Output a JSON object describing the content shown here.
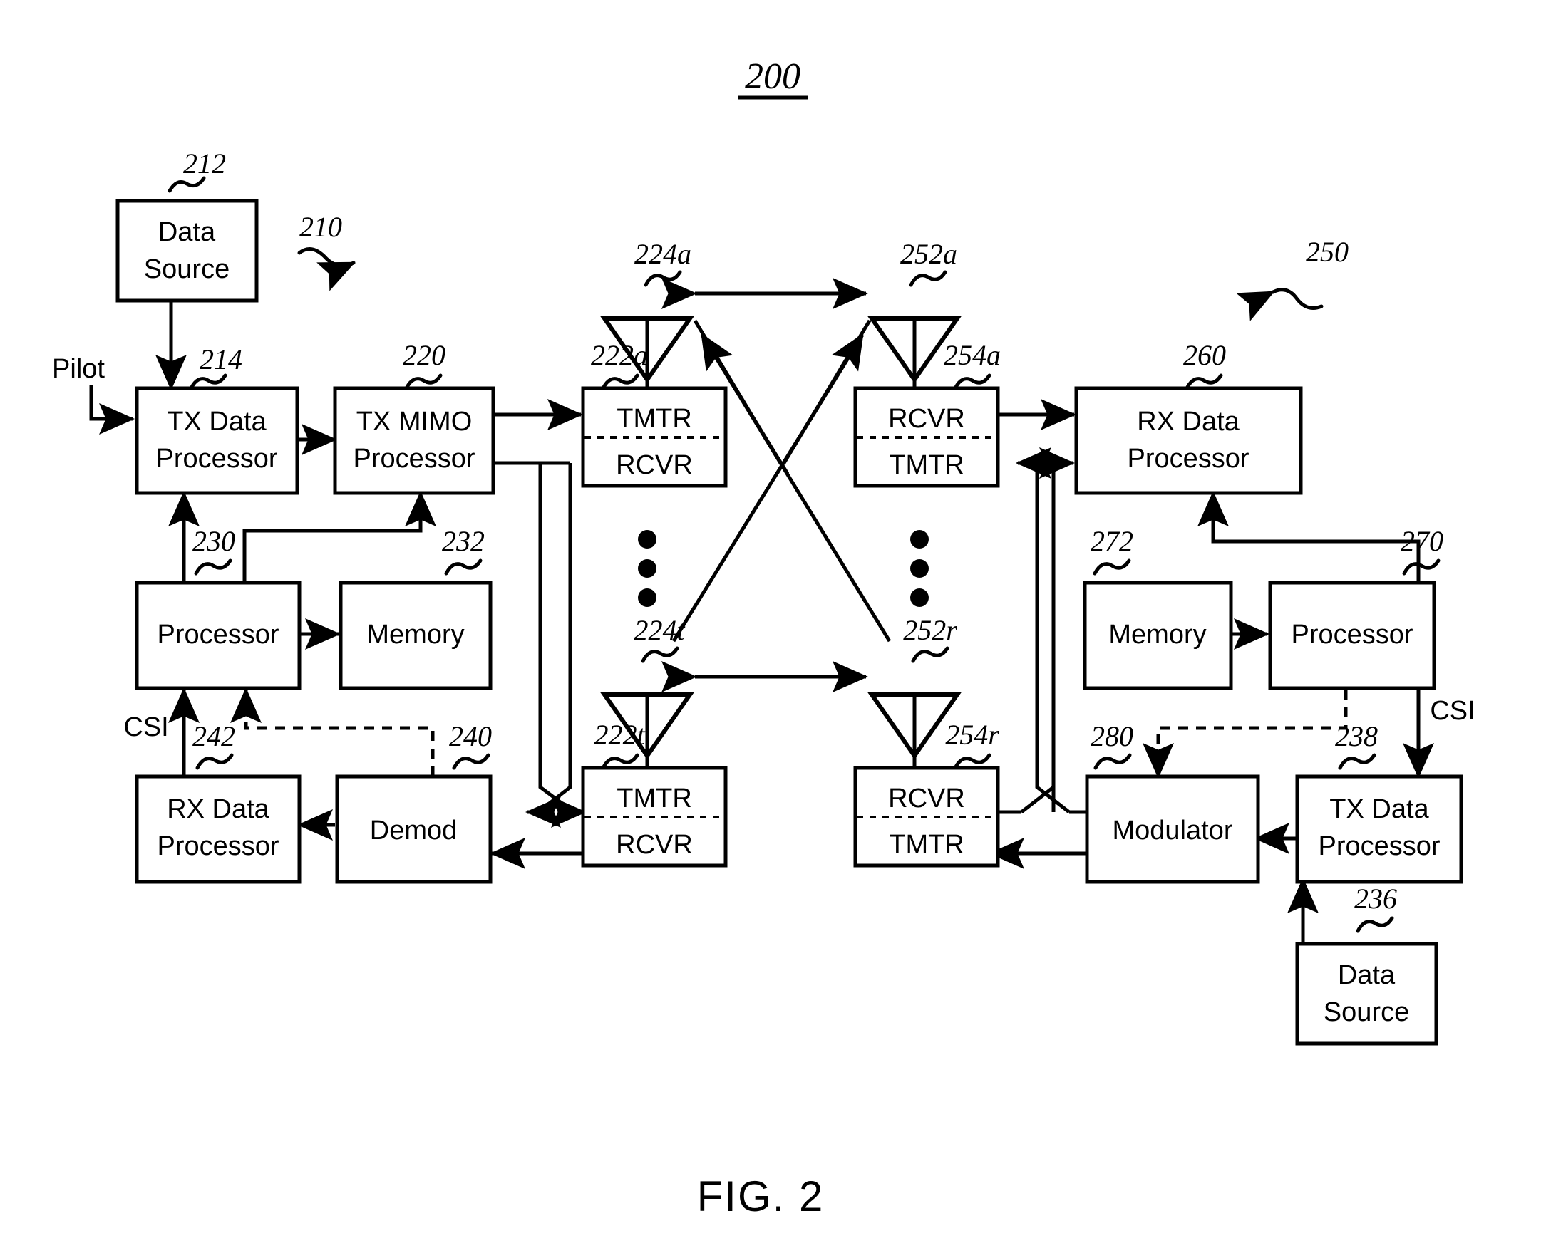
{
  "figure": {
    "number": "200",
    "caption": "FIG. 2"
  },
  "signals": {
    "pilot": "Pilot",
    "csi_left": "CSI",
    "csi_right": "CSI"
  },
  "group_refs": {
    "transmitter_system": "210",
    "receiver_system": "250"
  },
  "blocks": [
    {
      "id": "data_source_tx",
      "ref": "212",
      "lines": [
        "Data",
        "Source"
      ]
    },
    {
      "id": "tx_data_processor",
      "ref": "214",
      "lines": [
        "TX Data",
        "Processor"
      ]
    },
    {
      "id": "tx_mimo_processor",
      "ref": "220",
      "lines": [
        "TX MIMO",
        "Processor"
      ]
    },
    {
      "id": "tmtr_rcvr_a",
      "ref": "222a",
      "lines": [
        "TMTR",
        "RCVR"
      ]
    },
    {
      "id": "tmtr_rcvr_t",
      "ref": "222t",
      "lines": [
        "TMTR",
        "RCVR"
      ]
    },
    {
      "id": "processor_tx",
      "ref": "230",
      "lines": [
        "Processor"
      ]
    },
    {
      "id": "memory_tx",
      "ref": "232",
      "lines": [
        "Memory"
      ]
    },
    {
      "id": "demod",
      "ref": "240",
      "lines": [
        "Demod"
      ]
    },
    {
      "id": "rx_data_processor_tx",
      "ref": "242",
      "lines": [
        "RX Data",
        "Processor"
      ]
    },
    {
      "id": "rcvr_tmtr_a",
      "ref": "254a",
      "lines": [
        "RCVR",
        "TMTR"
      ]
    },
    {
      "id": "rcvr_tmtr_r",
      "ref": "254r",
      "lines": [
        "RCVR",
        "TMTR"
      ]
    },
    {
      "id": "rx_data_processor_rx",
      "ref": "260",
      "lines": [
        "RX Data",
        "Processor"
      ]
    },
    {
      "id": "memory_rx",
      "ref": "272",
      "lines": [
        "Memory"
      ]
    },
    {
      "id": "processor_rx",
      "ref": "270",
      "lines": [
        "Processor"
      ]
    },
    {
      "id": "modulator",
      "ref": "280",
      "lines": [
        "Modulator"
      ]
    },
    {
      "id": "tx_data_processor_rx",
      "ref": "238",
      "lines": [
        "TX Data",
        "Processor"
      ]
    },
    {
      "id": "data_source_rx",
      "ref": "236",
      "lines": [
        "Data",
        "Source"
      ]
    }
  ],
  "antennas": [
    {
      "id": "ant_224a",
      "ref": "224a"
    },
    {
      "id": "ant_224t",
      "ref": "224t"
    },
    {
      "id": "ant_252a",
      "ref": "252a"
    },
    {
      "id": "ant_252r",
      "ref": "252r"
    }
  ],
  "labels": {
    "data": "Data",
    "source": "Source",
    "tx_data": "TX Data",
    "processor": "Processor",
    "tx_mimo": "TX MIMO",
    "tmtr": "TMTR",
    "rcvr": "RCVR",
    "memory": "Memory",
    "demod": "Demod",
    "rx_data": "RX Data",
    "modulator": "Modulator"
  },
  "colors": {
    "line": "#000000",
    "background": "#ffffff"
  }
}
